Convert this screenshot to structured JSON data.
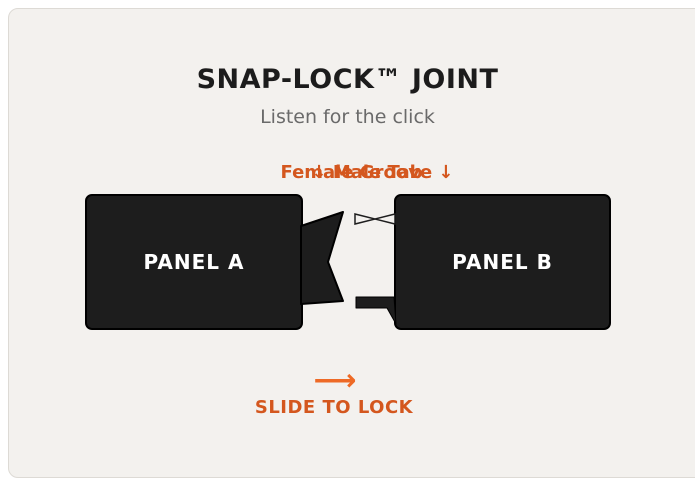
{
  "diagram": {
    "title": "SNAP-LOCK™ JOINT",
    "subtitle": "Listen for the click",
    "callout_left": "↓ Male Tab",
    "callout_right": "Female Groove ↓",
    "panel_a_label": "PANEL A",
    "panel_b_label": "PANEL B",
    "direction_arrow": "⟶",
    "action_label": "SLIDE TO LOCK"
  },
  "colors": {
    "background": "#f3f1ee",
    "panel_fill": "#1d1d1d",
    "accent": "#d4571e",
    "arrow": "#ee6a26"
  },
  "icons": {
    "direction": "arrow-right-icon"
  }
}
